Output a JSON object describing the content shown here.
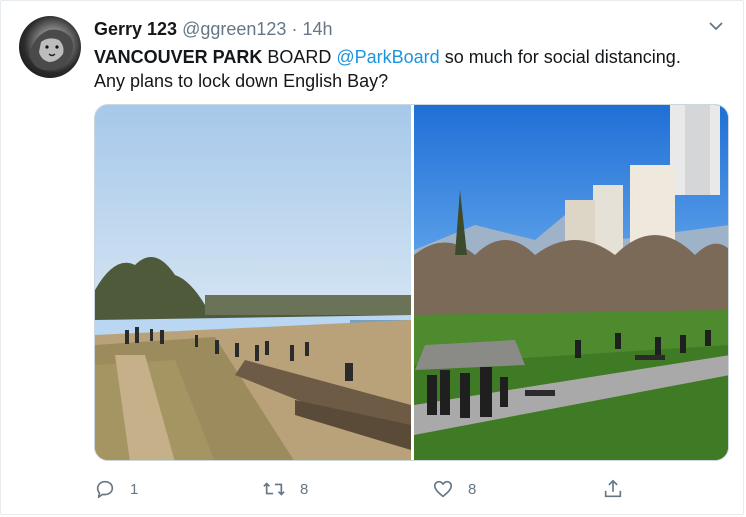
{
  "tweet": {
    "author_name": "Gerry 123",
    "handle": "@ggreen123",
    "separator": "·",
    "time": "14h",
    "text_bold": "VANCOUVER PARK",
    "text_1": " BOARD ",
    "mention": "@ParkBoard",
    "text_2": " so much for social distancing. Any plans to lock down English Bay?"
  },
  "media": {
    "photos": [
      {
        "name": "beach-photo-left"
      },
      {
        "name": "park-photo-right"
      }
    ]
  },
  "actions": {
    "reply_count": "1",
    "retweet_count": "8",
    "like_count": "8"
  },
  "icons": [
    "avatar",
    "chevron-down-icon",
    "reply-icon",
    "retweet-icon",
    "like-icon",
    "share-icon"
  ],
  "colors": {
    "accent": "#1b95e0",
    "muted": "#657786",
    "text": "#14171a"
  }
}
